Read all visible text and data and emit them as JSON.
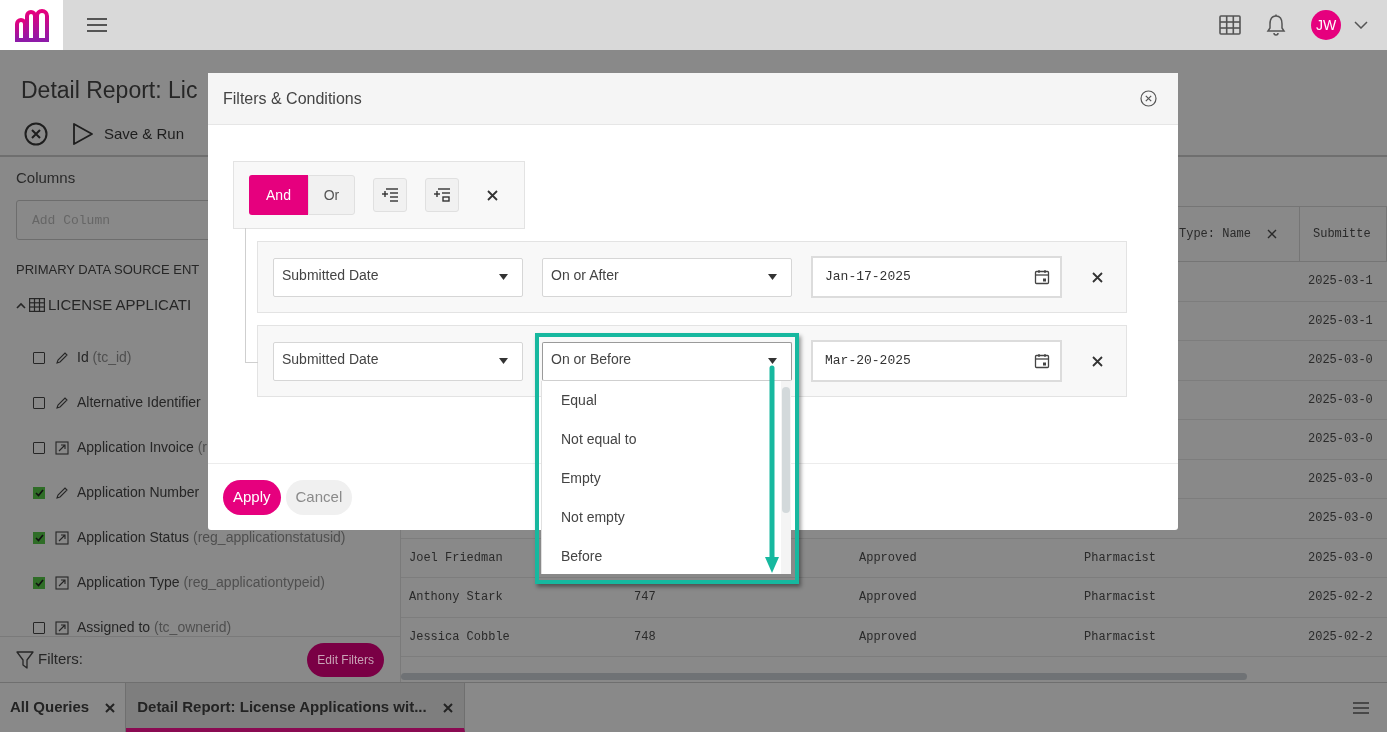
{
  "topbar": {
    "avatar_initials": "JW"
  },
  "page": {
    "title": "Detail Report: Lic",
    "save_label": "Save & Run"
  },
  "columns_panel": {
    "heading": "Columns",
    "search": {
      "placeholder": "Add Column"
    },
    "section_label": "PRIMARY DATA SOURCE ENT",
    "entity": {
      "label": "LICENSE APPLICATI",
      "expanded": true
    },
    "fields": [
      {
        "kind": "text",
        "name": "Id",
        "field": "(tc_id)",
        "checked": false
      },
      {
        "kind": "text",
        "name": "Alternative Identifier",
        "checked": false
      },
      {
        "kind": "lookup",
        "name": "Application Invoice",
        "field": "(r",
        "checked": false
      },
      {
        "kind": "text",
        "name": "Application Number",
        "checked": true
      },
      {
        "kind": "lookup",
        "name": "Application Status",
        "field": "(reg_applicationstatusid)",
        "checked": true
      },
      {
        "kind": "lookup",
        "name": "Application Type",
        "field": "(reg_applicationtypeid)",
        "checked": true
      },
      {
        "kind": "lookup",
        "name": "Assigned to",
        "field": "(tc_ownerid)",
        "checked": false
      }
    ],
    "filters_label": "Filters:",
    "edit_filters": "Edit Filters"
  },
  "table": {
    "columns": [
      {
        "label": "Type: Name",
        "removable": true
      },
      {
        "label": "Submitte",
        "removable": false
      }
    ],
    "rows": [
      {
        "column_5": "2025-03-1"
      },
      {
        "column_5": "2025-03-1"
      },
      {
        "column_5": "2025-03-0"
      },
      {
        "column_5": "2025-03-0"
      },
      {
        "column_5": "2025-03-0"
      },
      {
        "column_5": "2025-03-0"
      },
      {
        "column_5": "2025-03-0"
      },
      {
        "column_1": "Joel Friedman",
        "column_3": "Approved",
        "column_4": "Pharmacist",
        "column_5": "2025-03-0"
      },
      {
        "column_1": "Anthony Stark",
        "column_2": "747",
        "column_3": "Approved",
        "column_4": "Pharmacist",
        "column_5": "2025-02-2"
      },
      {
        "column_1": "Jessica Cobble",
        "column_2": "748",
        "column_3": "Approved",
        "column_4": "Pharmacist",
        "column_5": "2025-02-2"
      }
    ]
  },
  "tabs": [
    {
      "label": "All Queries",
      "selected": false
    },
    {
      "label": "Detail Report: License Applications wit...",
      "selected": true
    }
  ],
  "modal": {
    "title": "Filters & Conditions",
    "logic": [
      {
        "label": "And",
        "selected": true
      },
      {
        "label": "Or",
        "selected": false
      }
    ],
    "conditions": [
      {
        "field": "Submitted Date",
        "operator": "On or After",
        "value": "Jan-17-2025",
        "open": false,
        "highlighted": false
      },
      {
        "field": "Submitted Date",
        "operator": "On or Before",
        "value": "Mar-20-2025",
        "open": true,
        "highlighted": true,
        "options": [
          "Equal",
          "Not equal to",
          "Empty",
          "Not empty",
          "Before"
        ]
      }
    ],
    "buttons": [
      {
        "label": "Apply",
        "kind": "primary"
      },
      {
        "label": "Cancel",
        "kind": "secondary"
      }
    ]
  }
}
